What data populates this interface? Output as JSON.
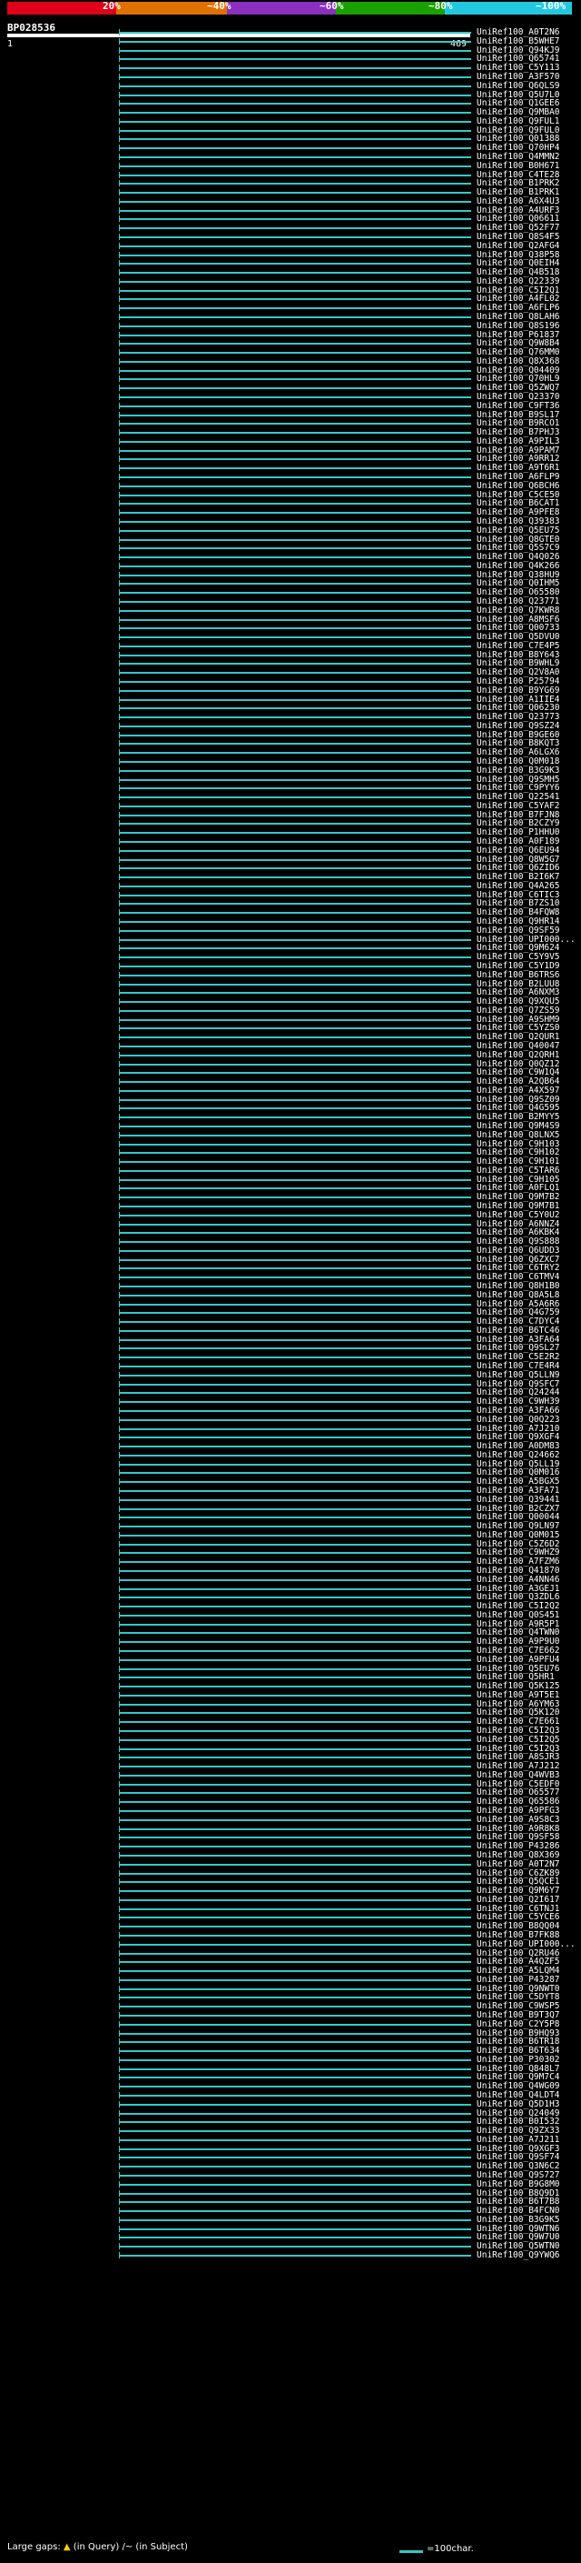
{
  "scale": {
    "ticks": [
      "20%",
      "~40%",
      "~60%",
      "~80%",
      "~100%"
    ],
    "colors": [
      "#e0001a",
      "#e08000",
      "#8a2fc0",
      "#1aa000",
      "#22c8e0"
    ]
  },
  "query": {
    "name": "BP028536",
    "start": "1",
    "end": "469"
  },
  "hits": [
    "UniRef100_A0T2N6",
    "UniRef100_B5WHE7",
    "UniRef100_Q94KJ9",
    "UniRef100_Q65741",
    "UniRef100_C5Y113",
    "UniRef100_A3F570",
    "UniRef100_Q6QLS9",
    "UniRef100_Q5U7L0",
    "UniRef100_Q1GEE6",
    "UniRef100_Q9MBA0",
    "UniRef100_Q9FUL1",
    "UniRef100_Q9FUL0",
    "UniRef100_Q01388",
    "UniRef100_Q70HP4",
    "UniRef100_Q4MMN2",
    "UniRef100_B0H671",
    "UniRef100_C4TE28",
    "UniRef100_B1PRK2",
    "UniRef100_B1PRK1",
    "UniRef100_A6X4U3",
    "UniRef100_A4URF3",
    "UniRef100_Q06611",
    "UniRef100_Q52F77",
    "UniRef100_Q8S4F5",
    "UniRef100_Q2AFG4",
    "UniRef100_Q38P58",
    "UniRef100_Q0EIH4",
    "UniRef100_Q4B518",
    "UniRef100_Q22339",
    "UniRef100_C5I2Q1",
    "UniRef100_A4FL02",
    "UniRef100_A6FLP6",
    "UniRef100_Q8LAH6",
    "UniRef100_Q8S196",
    "UniRef100_P61837",
    "UniRef100_Q9W8B4",
    "UniRef100_Q76MM0",
    "UniRef100_Q8X368",
    "UniRef100_Q04409",
    "UniRef100_Q70HL9",
    "UniRef100_Q5ZWQ7",
    "UniRef100_Q23370",
    "UniRef100_C9FT36",
    "UniRef100_B9SL17",
    "UniRef100_B9RCO1",
    "UniRef100_B7PHJ3",
    "UniRef100_A9PIL3",
    "UniRef100_A9PAM7",
    "UniRef100_A9RR12",
    "UniRef100_A9T6R1",
    "UniRef100_A6FLP9",
    "UniRef100_Q6BCH6",
    "UniRef100_C5CE50",
    "UniRef100_B6CAT1",
    "UniRef100_A9PFE8",
    "UniRef100_Q39383",
    "UniRef100_Q5EU75",
    "UniRef100_Q8GTE0",
    "UniRef100_Q5S7C9",
    "UniRef100_Q4Q026",
    "UniRef100_Q4K266",
    "UniRef100_Q38HU9",
    "UniRef100_Q0IHM5",
    "UniRef100_O65580",
    "UniRef100_Q23771",
    "UniRef100_Q7KWR8",
    "UniRef100_A8MSF6",
    "UniRef100_Q00733",
    "UniRef100_Q5DVU0",
    "UniRef100_C7E4P5",
    "UniRef100_B8Y643",
    "UniRef100_B9WHL9",
    "UniRef100_Q2V8A0",
    "UniRef100_P25794",
    "UniRef100_B9YG69",
    "UniRef100_A1IIE4",
    "UniRef100_Q06230",
    "UniRef100_Q23773",
    "UniRef100_Q9SZ24",
    "UniRef100_B9GE60",
    "UniRef100_B8KQT3",
    "UniRef100_A6LGX6",
    "UniRef100_Q0M018",
    "UniRef100_B3G9K3",
    "UniRef100_Q9SMH5",
    "UniRef100_C9PYY6",
    "UniRef100_Q22541",
    "UniRef100_C5YAF2",
    "UniRef100_B7FJN8",
    "UniRef100_B2CZY9",
    "UniRef100_P1HHU0",
    "UniRef100_A0F189",
    "UniRef100_Q6EU94",
    "UniRef100_Q8W5G7",
    "UniRef100_Q6ZID6",
    "UniRef100_B2I6K7",
    "UniRef100_Q4A265",
    "UniRef100_C6TIC3",
    "UniRef100_B7ZS10",
    "UniRef100_B4FQW8",
    "UniRef100_Q9HR14",
    "UniRef100_Q9SF59",
    "UniRef100_UPI000...",
    "UniRef100_Q9M624",
    "UniRef100_C5Y9V5",
    "UniRef100_C5Y1D9",
    "UniRef100_B6TRS6",
    "UniRef100_B2LUU8",
    "UniRef100_A6NXM3",
    "UniRef100_Q9XQU5",
    "UniRef100_Q7ZS59",
    "UniRef100_A9SHM9",
    "UniRef100_C5YZS0",
    "UniRef100_Q2QUR1",
    "UniRef100_Q40047",
    "UniRef100_Q2QRH1",
    "UniRef100_Q0QZ12",
    "UniRef100_C9W1Q4",
    "UniRef100_A2QB64",
    "UniRef100_A4X597",
    "UniRef100_Q9SZ09",
    "UniRef100_Q4G595",
    "UniRef100_B2MYY5",
    "UniRef100_Q9M4S9",
    "UniRef100_Q8LNX5",
    "UniRef100_C9H103",
    "UniRef100_C9H102",
    "UniRef100_C9H101",
    "UniRef100_C5TAR6",
    "UniRef100_C9H105",
    "UniRef100_A0FLQ1",
    "UniRef100_Q9M7B2",
    "UniRef100_Q9M7B1",
    "UniRef100_C5Y0U2",
    "UniRef100_A6NNZ4",
    "UniRef100_A6KBK4",
    "UniRef100_Q9S888",
    "UniRef100_Q6UDD3",
    "UniRef100_Q6ZXC7",
    "UniRef100_C6TRY2",
    "UniRef100_C6TMV4",
    "UniRef100_Q8H1B0",
    "UniRef100_Q8A5L8",
    "UniRef100_A5A6R6",
    "UniRef100_Q4G759",
    "UniRef100_C7DYC4",
    "UniRef100_B6TC46",
    "UniRef100_A3FA64",
    "UniRef100_Q9SL27",
    "UniRef100_C5E2R2",
    "UniRef100_C7E4R4",
    "UniRef100_Q5LLN9",
    "UniRef100_Q9SFC7",
    "UniRef100_Q24244",
    "UniRef100_C9WH39",
    "UniRef100_A3FA66",
    "UniRef100_Q0Q223",
    "UniRef100_A7J210",
    "UniRef100_Q9XGF4",
    "UniRef100_A0DM83",
    "UniRef100_Q24662",
    "UniRef100_Q5LL19",
    "UniRef100_Q0M016",
    "UniRef100_A5BGX5",
    "UniRef100_A3FA71",
    "UniRef100_Q39441",
    "UniRef100_B2CZX7",
    "UniRef100_Q00044",
    "UniRef100_Q9LN97",
    "UniRef100_Q0M015",
    "UniRef100_C5Z6D2",
    "UniRef100_C9WHZ9",
    "UniRef100_A7FZM6",
    "UniRef100_Q41870",
    "UniRef100_A4NN46",
    "UniRef100_A3GEJ1",
    "UniRef100_Q3ZDL6",
    "UniRef100_C5I2Q2",
    "UniRef100_Q0S451",
    "UniRef100_A9R5P1",
    "UniRef100_Q4TWN0",
    "UniRef100_A9P9U0",
    "UniRef100_C7E662",
    "UniRef100_A9PFU4",
    "UniRef100_Q5EU76",
    "UniRef100_Q5HR1",
    "UniRef100_Q5K125",
    "UniRef100_A9T5E1",
    "UniRef100_A6YM63",
    "UniRef100_Q5K120",
    "UniRef100_C7E661",
    "UniRef100_C5I2Q3",
    "UniRef100_C5I2Q5",
    "UniRef100_C5I2Q3",
    "UniRef100_A8SJR3",
    "UniRef100_A7J212",
    "UniRef100_Q4WVB3",
    "UniRef100_C5EDF0",
    "UniRef100_O65577",
    "UniRef100_Q65586",
    "UniRef100_A9PFG3",
    "UniRef100_A9S8C3",
    "UniRef100_A9R8K8",
    "UniRef100_Q9SF58",
    "UniRef100_P43286",
    "UniRef100_Q8X369",
    "UniRef100_A0T2N7",
    "UniRef100_C6ZK89",
    "UniRef100_Q5QCE1",
    "UniRef100_Q9M6Y7",
    "UniRef100_Q2I617",
    "UniRef100_C6TNJ1",
    "UniRef100_C5YCE6",
    "UniRef100_B8QQ04",
    "UniRef100_B7FK88",
    "UniRef100_UPI000...",
    "UniRef100_Q2RU46",
    "UniRef100_A4QZF5",
    "UniRef100_A5LQM4",
    "UniRef100_P43287",
    "UniRef100_Q9NWT0",
    "UniRef100_C5DYT8",
    "UniRef100_C9WSP5",
    "UniRef100_B9T3Q7",
    "UniRef100_C2Y5P8",
    "UniRef100_B9HQ93",
    "UniRef100_B6TR18",
    "UniRef100_B6T634",
    "UniRef100_P30302",
    "UniRef100_Q848L7",
    "UniRef100_Q9M7C4",
    "UniRef100_Q4WG09",
    "UniRef100_Q4LDT4",
    "UniRef100_Q5D1H3",
    "UniRef100_Q24049",
    "UniRef100_B0I532",
    "UniRef100_Q9ZX33",
    "UniRef100_A7J211",
    "UniRef100_Q9XGF3",
    "UniRef100_Q9SF74",
    "UniRef100_Q3N6C2",
    "UniRef100_Q9S727",
    "UniRef100_B9G8M0",
    "UniRef100_B8Q9D1",
    "UniRef100_B6T7B8",
    "UniRef100_B4FCN0",
    "UniRef100_B3G9K5",
    "UniRef100_Q9WTN6",
    "UniRef100_Q9W7U0",
    "UniRef100_Q5WTN0",
    "UniRef100_Q9YWQ6"
  ],
  "footer": {
    "large_gaps_label": "Large gaps:",
    "in_query": "(in Query)",
    "in_subject": "(in Subject)",
    "legend_label": "=100char."
  }
}
